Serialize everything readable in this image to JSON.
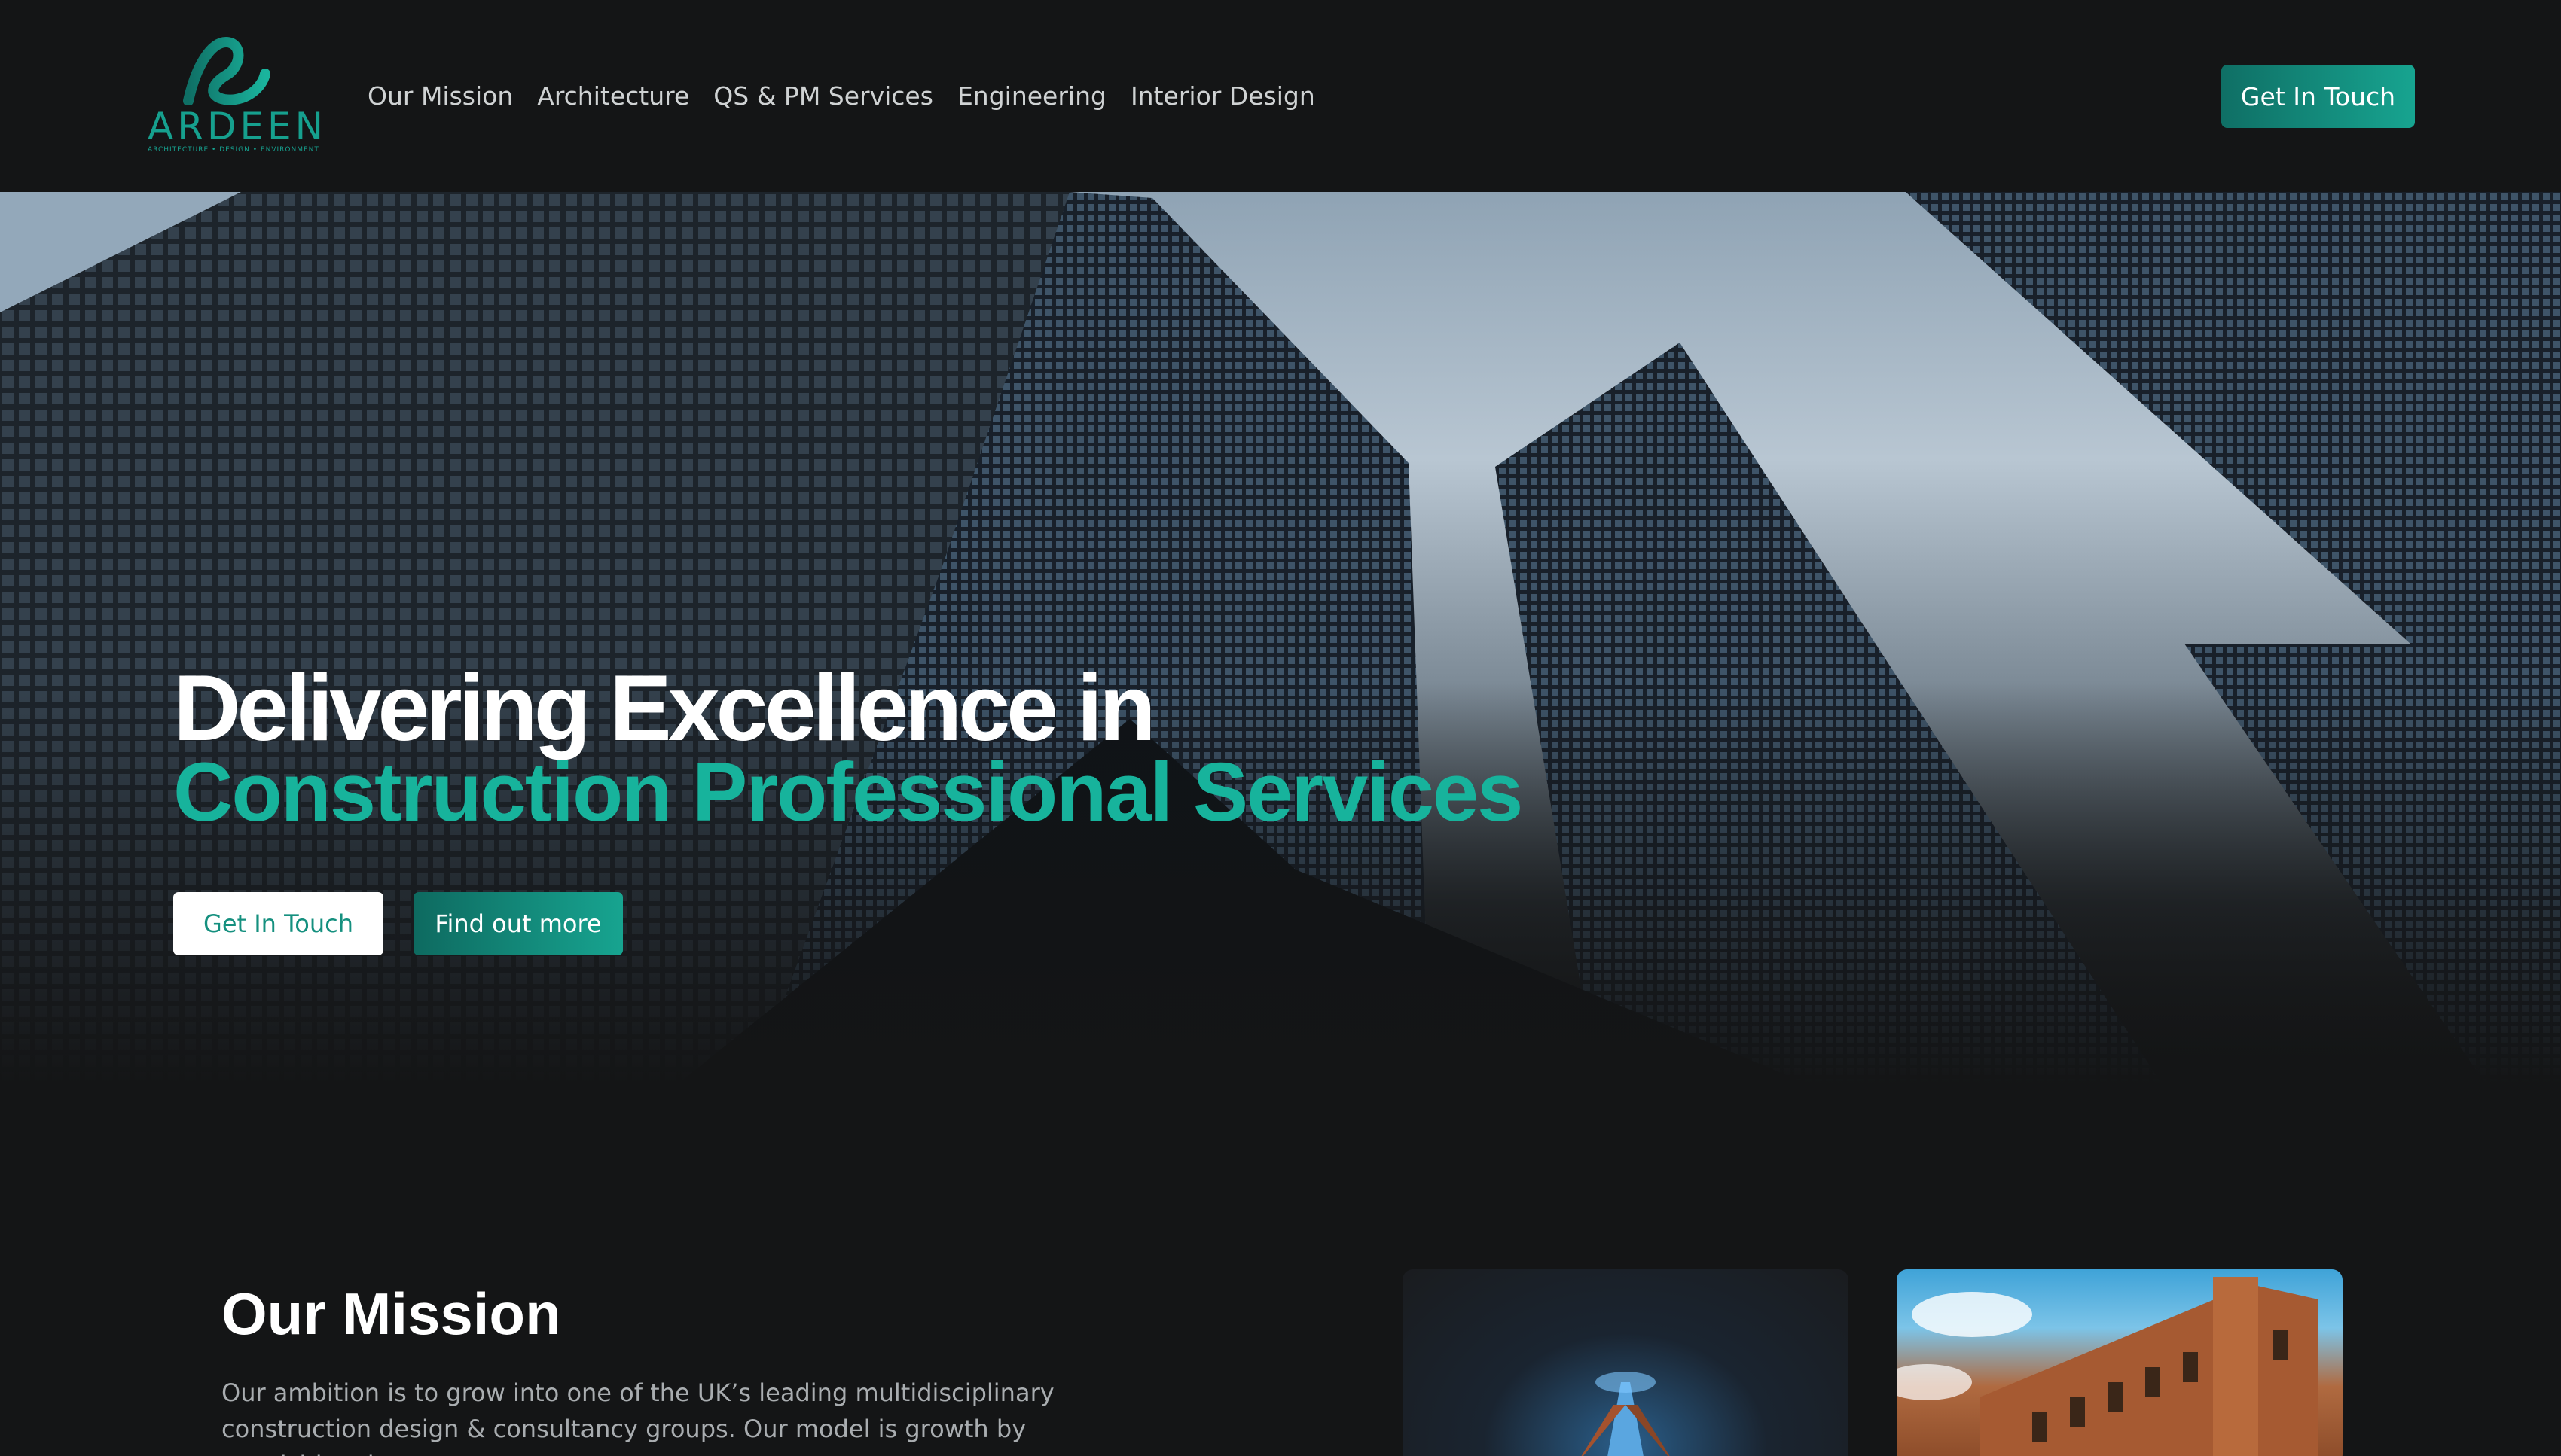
{
  "brand": {
    "name": "ARDEEN",
    "tagline": "ARCHITECTURE • DESIGN • ENVIRONMENT",
    "accent": "#17a490"
  },
  "nav": {
    "items": [
      "Our Mission",
      "Architecture",
      "QS & PM Services",
      "Engineering",
      "Interior Design"
    ]
  },
  "header": {
    "cta_label": "Get In Touch"
  },
  "hero": {
    "title_line1": "Delivering Excellence in",
    "title_line2": "Construction Professional Services",
    "primary_label": "Get In Touch",
    "secondary_label": "Find out more"
  },
  "mission": {
    "title": "Our Mission",
    "text": "Our ambition is to grow into one of the UK’s leading multidisciplinary construction design & consultancy groups. Our model is growth by acquisition, but more"
  }
}
